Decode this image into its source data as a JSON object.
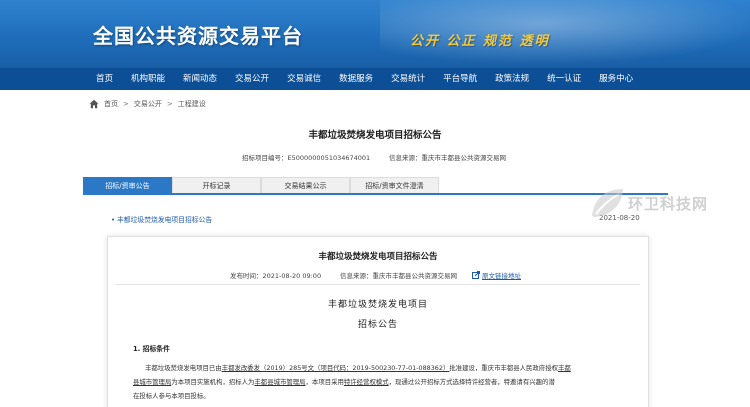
{
  "header": {
    "site_title": "全国公共资源交易平台",
    "slogan": "公开 公正 规范 透明"
  },
  "nav": {
    "items": [
      "首页",
      "机构职能",
      "新闻动态",
      "交易公开",
      "交易诚信",
      "数据服务",
      "交易统计",
      "平台导航",
      "政策法规",
      "统一认证",
      "服务中心"
    ]
  },
  "breadcrumb": {
    "home": "首页",
    "sep": ">",
    "level1": "交易公开",
    "level2": "工程建设"
  },
  "page": {
    "title": "丰都垃圾焚烧发电项目招标公告",
    "project_no_label": "招标项目编号：",
    "project_no": "E5000000051034674001",
    "source_label": "信息来源：",
    "source": "重庆市丰都县公共资源交易网"
  },
  "tabs": [
    {
      "label": "招标/资审公告",
      "active": true
    },
    {
      "label": "开标记录",
      "active": false
    },
    {
      "label": "交易结果公示",
      "active": false
    },
    {
      "label": "招标/资审文件澄清",
      "active": false
    }
  ],
  "project_link": {
    "bullet": "•",
    "text": "丰都垃圾焚烧发电项目招标公告",
    "date": "2021-08-20"
  },
  "watermark": {
    "text": "环卫科技网"
  },
  "notice": {
    "title": "丰都垃圾焚烧发电项目招标公告",
    "publish_label": "发布时间：",
    "publish_time": "2021-08-20 09:00",
    "source_label": "信息来源：",
    "source": "重庆市丰都县公共资源交易网",
    "original_link": "原文链接地址",
    "doc_title": "丰都垃圾焚烧发电项目",
    "doc_subtitle": "招标公告",
    "section1": "1. 招标条件",
    "line1_a": "丰都垃圾焚烧发电项目已由",
    "line1_b": "丰都发改委发（2019）285号文（项目代码：2019-500230-77-01-088362）",
    "line1_c": "批准建设，重庆市丰都县人民政府授权",
    "line1_d": "丰都",
    "line2_a": "县城市管理局",
    "line2_b": "为本项目实施机构，招标人为",
    "line2_c": "丰都县城市管理局",
    "line2_d": "，本项目采用",
    "line2_e": "特许经营权模式",
    "line2_f": "，现通过公开招标方式选择特许经营者，特邀请有兴趣的潜",
    "line3": "在投标人参与本项目投标。"
  },
  "colors": {
    "banner": "#1e6cb9",
    "navbar": "#0d4f96",
    "tab_active": "#2b78c6",
    "link": "#1f5aa6",
    "slogan": "#f5c93a"
  }
}
